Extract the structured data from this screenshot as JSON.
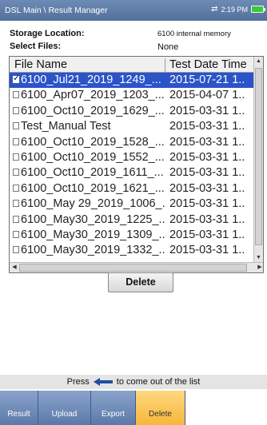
{
  "header": {
    "title": "DSL Main \\ Result Manager",
    "time": "2:19 PM"
  },
  "storage": {
    "label": "Storage Location:",
    "value": "6100 internal memory"
  },
  "select_files": {
    "label": "Select Files:",
    "value": "None"
  },
  "table": {
    "columns": [
      "File Name",
      "Test Date Time"
    ],
    "rows": [
      {
        "name": "6100_Jul21_2019_1249_...",
        "date": "2015-07-21 1..",
        "checked": true,
        "selected": true
      },
      {
        "name": "6100_Apr07_2019_1203_...",
        "date": "2015-04-07 1..",
        "checked": false,
        "selected": false
      },
      {
        "name": "6100_Oct10_2019_1629_...",
        "date": "2015-03-31 1..",
        "checked": false,
        "selected": false
      },
      {
        "name": "Test_Manual Test",
        "date": "2015-03-31 1..",
        "checked": false,
        "selected": false
      },
      {
        "name": "6100_Oct10_2019_1528_...",
        "date": "2015-03-31 1..",
        "checked": false,
        "selected": false
      },
      {
        "name": "6100_Oct10_2019_1552_...",
        "date": "2015-03-31 1..",
        "checked": false,
        "selected": false
      },
      {
        "name": "6100_Oct10_2019_1611_...",
        "date": "2015-03-31 1..",
        "checked": false,
        "selected": false
      },
      {
        "name": "6100_Oct10_2019_1621_...",
        "date": "2015-03-31 1..",
        "checked": false,
        "selected": false
      },
      {
        "name": "6100_May 29_2019_1006_...",
        "date": "2015-03-31 1..",
        "checked": false,
        "selected": false
      },
      {
        "name": "6100_May30_2019_1225_...",
        "date": "2015-03-31 1..",
        "checked": false,
        "selected": false
      },
      {
        "name": "6100_May30_2019_1309_...",
        "date": "2015-03-31 1..",
        "checked": false,
        "selected": false
      },
      {
        "name": "6100_May30_2019_1332_...",
        "date": "2015-03-31 1..",
        "checked": false,
        "selected": false
      }
    ]
  },
  "delete_button": "Delete",
  "hint": {
    "before": "Press",
    "after": "to come out of the list"
  },
  "bottom_tabs": [
    "Result",
    "Upload",
    "Export",
    "Delete"
  ],
  "icons": [
    "sync-icon",
    "battery-icon",
    "back-arrow-icon",
    "checkbox-icon"
  ],
  "colors": {
    "titlebar": "#5f7faa",
    "selection": "#2b54c9",
    "highlight_tab": "#f5b73a",
    "battery": "#3cc63c"
  }
}
